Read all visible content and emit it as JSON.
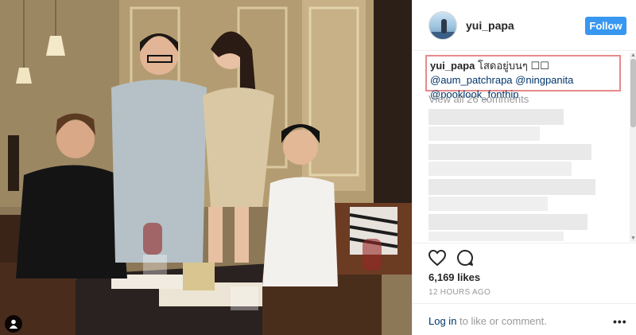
{
  "header": {
    "username": "yui_papa",
    "follow_label": "Follow"
  },
  "caption": {
    "username": "yui_papa",
    "text": "โสดอยู่บนๆ ☐☐",
    "mentions": [
      "@aum_patchrapa",
      "@ningpanita",
      "@pooklook_fonthip"
    ]
  },
  "comments": {
    "view_all_label": "View all 26 comments"
  },
  "actions": {
    "likes": "6,169 likes",
    "timestamp": "12 HOURS AGO"
  },
  "footer": {
    "login_link": "Log in",
    "login_rest": " to like or comment.",
    "more_label": "•••"
  },
  "icons": {
    "user_tag": "person-icon",
    "like": "heart-icon",
    "comment": "comment-icon",
    "more": "more-options-icon"
  },
  "colors": {
    "follow_button": "#3897f0",
    "highlight_border": "#e88a8a",
    "mention_link": "#003569",
    "muted_text": "#999999"
  }
}
